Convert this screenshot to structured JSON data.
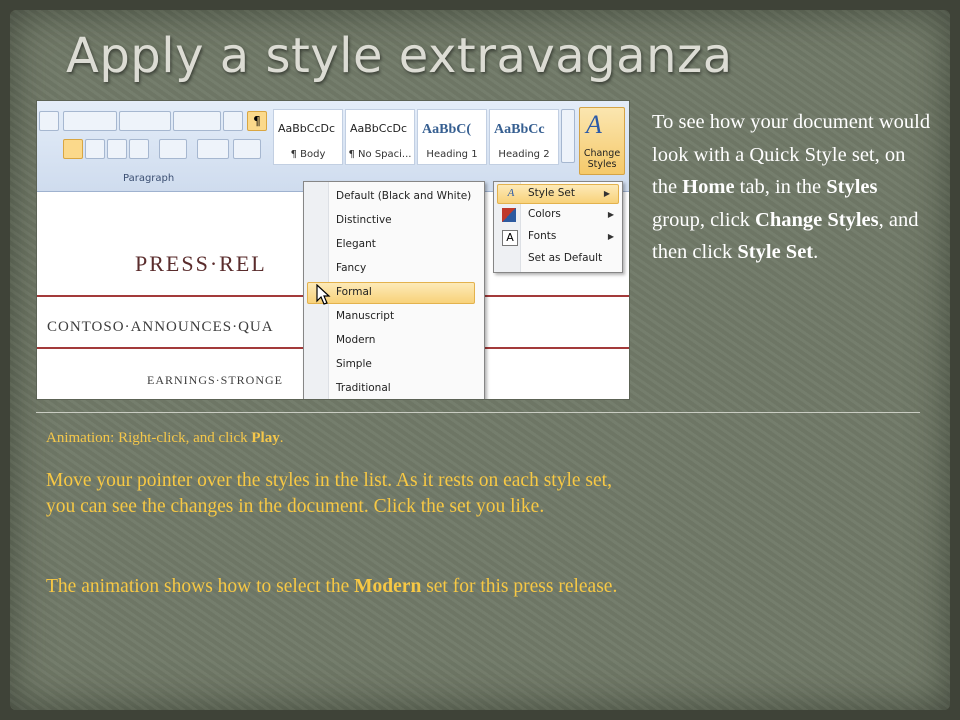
{
  "title": "Apply a style extravaganza",
  "screenshot": {
    "ribbon": {
      "group_label": "Paragraph",
      "styles": [
        {
          "preview": "AaBbCcDc",
          "name": "¶ Body",
          "heading": false
        },
        {
          "preview": "AaBbCcDc",
          "name": "¶ No Spaci...",
          "heading": false
        },
        {
          "preview": "AaBbC(",
          "name": "Heading 1",
          "heading": true
        },
        {
          "preview": "AaBbCc",
          "name": "Heading 2",
          "heading": true
        }
      ],
      "change_styles_label": "Change Styles"
    },
    "document": {
      "heading": "PRESS·REL",
      "subheading": "CONTOSO·ANNOUNCES·QUA",
      "tagline": "EARNINGS·STRONGE"
    },
    "style_set_menu": {
      "items": [
        "Default (Black and White)",
        "Distinctive",
        "Elegant",
        "Fancy",
        "Formal",
        "Manuscript",
        "Modern",
        "Simple",
        "Traditional"
      ],
      "highlighted": "Formal"
    },
    "change_styles_menu": {
      "items": [
        {
          "label": "Style Set",
          "icon": "style-set-icon",
          "submenu": true
        },
        {
          "label": "Colors",
          "icon": "colors-icon",
          "submenu": true
        },
        {
          "label": "Fonts",
          "icon": "fonts-icon",
          "submenu": true
        },
        {
          "label": "Set as Default",
          "icon": "",
          "submenu": false
        }
      ],
      "highlighted": "Style Set"
    }
  },
  "side_text": {
    "p1": "To see how your document would look with a Quick Style set, on the ",
    "home": "Home",
    "p2": " tab, in the ",
    "styles": "Styles",
    "p3": " group, click ",
    "change_styles": "Change Styles",
    "p4": ", and then click ",
    "style_set": "Style Set",
    "p5": "."
  },
  "animation_note": {
    "prefix": "Animation: Right-click, and click ",
    "action": "Play",
    "suffix": "."
  },
  "paragraph1": "Move your pointer over the styles in the list. As it rests on each style set, you can see the changes in the document. Click the set you like.",
  "paragraph2": {
    "prefix": "The animation shows how to select the ",
    "set_name": "Modern",
    "suffix": " set for this press release."
  },
  "colors": {
    "background": "#717a68",
    "title": "#dcdcd4",
    "highlight_text": "#f7c844",
    "body_text": "#ffffff"
  }
}
